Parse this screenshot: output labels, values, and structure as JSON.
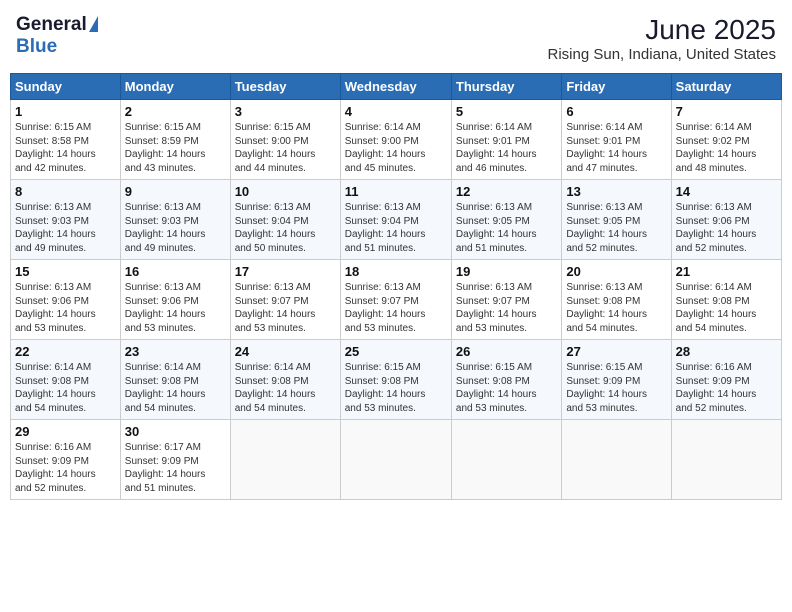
{
  "logo": {
    "general": "General",
    "blue": "Blue"
  },
  "title": {
    "month_year": "June 2025",
    "location": "Rising Sun, Indiana, United States"
  },
  "days_of_week": [
    "Sunday",
    "Monday",
    "Tuesday",
    "Wednesday",
    "Thursday",
    "Friday",
    "Saturday"
  ],
  "weeks": [
    [
      {
        "day": 1,
        "sunrise": "6:15 AM",
        "sunset": "8:58 PM",
        "daylight": "14 hours and 42 minutes."
      },
      {
        "day": 2,
        "sunrise": "6:15 AM",
        "sunset": "8:59 PM",
        "daylight": "14 hours and 43 minutes."
      },
      {
        "day": 3,
        "sunrise": "6:15 AM",
        "sunset": "9:00 PM",
        "daylight": "14 hours and 44 minutes."
      },
      {
        "day": 4,
        "sunrise": "6:14 AM",
        "sunset": "9:00 PM",
        "daylight": "14 hours and 45 minutes."
      },
      {
        "day": 5,
        "sunrise": "6:14 AM",
        "sunset": "9:01 PM",
        "daylight": "14 hours and 46 minutes."
      },
      {
        "day": 6,
        "sunrise": "6:14 AM",
        "sunset": "9:01 PM",
        "daylight": "14 hours and 47 minutes."
      },
      {
        "day": 7,
        "sunrise": "6:14 AM",
        "sunset": "9:02 PM",
        "daylight": "14 hours and 48 minutes."
      }
    ],
    [
      {
        "day": 8,
        "sunrise": "6:13 AM",
        "sunset": "9:03 PM",
        "daylight": "14 hours and 49 minutes."
      },
      {
        "day": 9,
        "sunrise": "6:13 AM",
        "sunset": "9:03 PM",
        "daylight": "14 hours and 49 minutes."
      },
      {
        "day": 10,
        "sunrise": "6:13 AM",
        "sunset": "9:04 PM",
        "daylight": "14 hours and 50 minutes."
      },
      {
        "day": 11,
        "sunrise": "6:13 AM",
        "sunset": "9:04 PM",
        "daylight": "14 hours and 51 minutes."
      },
      {
        "day": 12,
        "sunrise": "6:13 AM",
        "sunset": "9:05 PM",
        "daylight": "14 hours and 51 minutes."
      },
      {
        "day": 13,
        "sunrise": "6:13 AM",
        "sunset": "9:05 PM",
        "daylight": "14 hours and 52 minutes."
      },
      {
        "day": 14,
        "sunrise": "6:13 AM",
        "sunset": "9:06 PM",
        "daylight": "14 hours and 52 minutes."
      }
    ],
    [
      {
        "day": 15,
        "sunrise": "6:13 AM",
        "sunset": "9:06 PM",
        "daylight": "14 hours and 53 minutes."
      },
      {
        "day": 16,
        "sunrise": "6:13 AM",
        "sunset": "9:06 PM",
        "daylight": "14 hours and 53 minutes."
      },
      {
        "day": 17,
        "sunrise": "6:13 AM",
        "sunset": "9:07 PM",
        "daylight": "14 hours and 53 minutes."
      },
      {
        "day": 18,
        "sunrise": "6:13 AM",
        "sunset": "9:07 PM",
        "daylight": "14 hours and 53 minutes."
      },
      {
        "day": 19,
        "sunrise": "6:13 AM",
        "sunset": "9:07 PM",
        "daylight": "14 hours and 53 minutes."
      },
      {
        "day": 20,
        "sunrise": "6:13 AM",
        "sunset": "9:08 PM",
        "daylight": "14 hours and 54 minutes."
      },
      {
        "day": 21,
        "sunrise": "6:14 AM",
        "sunset": "9:08 PM",
        "daylight": "14 hours and 54 minutes."
      }
    ],
    [
      {
        "day": 22,
        "sunrise": "6:14 AM",
        "sunset": "9:08 PM",
        "daylight": "14 hours and 54 minutes."
      },
      {
        "day": 23,
        "sunrise": "6:14 AM",
        "sunset": "9:08 PM",
        "daylight": "14 hours and 54 minutes."
      },
      {
        "day": 24,
        "sunrise": "6:14 AM",
        "sunset": "9:08 PM",
        "daylight": "14 hours and 54 minutes."
      },
      {
        "day": 25,
        "sunrise": "6:15 AM",
        "sunset": "9:08 PM",
        "daylight": "14 hours and 53 minutes."
      },
      {
        "day": 26,
        "sunrise": "6:15 AM",
        "sunset": "9:08 PM",
        "daylight": "14 hours and 53 minutes."
      },
      {
        "day": 27,
        "sunrise": "6:15 AM",
        "sunset": "9:09 PM",
        "daylight": "14 hours and 53 minutes."
      },
      {
        "day": 28,
        "sunrise": "6:16 AM",
        "sunset": "9:09 PM",
        "daylight": "14 hours and 52 minutes."
      }
    ],
    [
      {
        "day": 29,
        "sunrise": "6:16 AM",
        "sunset": "9:09 PM",
        "daylight": "14 hours and 52 minutes."
      },
      {
        "day": 30,
        "sunrise": "6:17 AM",
        "sunset": "9:09 PM",
        "daylight": "14 hours and 51 minutes."
      },
      null,
      null,
      null,
      null,
      null
    ]
  ],
  "labels": {
    "sunrise": "Sunrise:",
    "sunset": "Sunset:",
    "daylight": "Daylight:"
  }
}
